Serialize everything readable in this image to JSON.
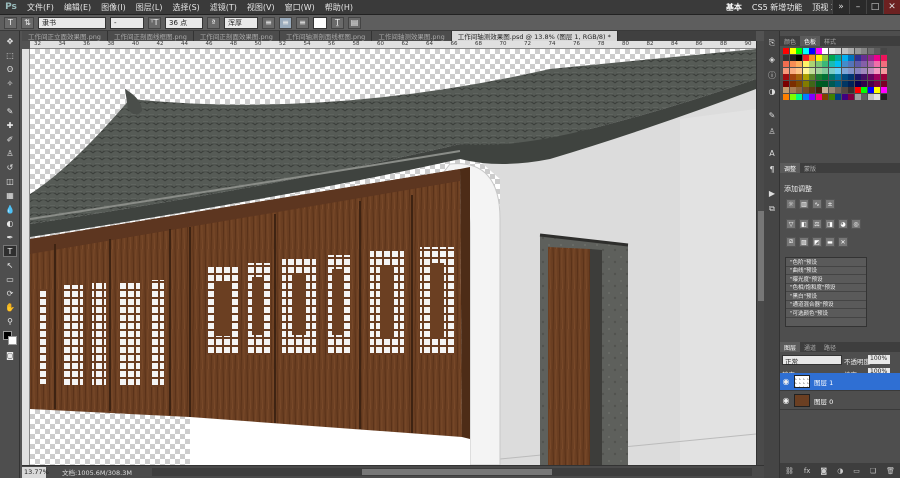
{
  "app": {
    "logo": "Ps"
  },
  "menu": [
    "文件(F)",
    "编辑(E)",
    "图像(I)",
    "图层(L)",
    "选择(S)",
    "滤镜(T)",
    "视图(V)",
    "窗口(W)",
    "帮助(H)"
  ],
  "workspace": {
    "basic": "基本",
    "cs5": "CS5 新增功能",
    "design3d": "顶视 3D"
  },
  "options": {
    "font_family": "隶书",
    "font_style": "-",
    "font_size": "36 点",
    "antialias": "浑厚",
    "zoom_field": "13.8"
  },
  "tabs": [
    "工作间正立面效果图.png",
    "工作间正剖面线框图.png",
    "工作间正剖面效果图.png",
    "工作间轴测剖面线框图.png",
    "工作间轴测效果图.png",
    "工作间轴测效果图.psd @ 13.8% (图层 1, RGB/8) *"
  ],
  "ruler": {
    "top": [
      "32",
      "34",
      "36",
      "38",
      "40",
      "42",
      "44",
      "46",
      "48",
      "50",
      "52",
      "54",
      "56",
      "58",
      "60",
      "62",
      "64",
      "66",
      "68",
      "70",
      "72",
      "74",
      "76",
      "78",
      "80",
      "82",
      "84",
      "86",
      "88",
      "90"
    ]
  },
  "status": {
    "zoom": "13.77%",
    "doc": "文档:1005.6M/308.3M"
  },
  "panels": {
    "swatch_tabs": [
      "颜色",
      "色板",
      "样式"
    ],
    "adjust_tabs": [
      "调整",
      "蒙版"
    ],
    "adjust_title": "添加调整",
    "presets": [
      "\"色阶\"预设",
      "\"曲线\"预设",
      "\"曝光度\"预设",
      "\"色相/饱和度\"预设",
      "\"黑白\"预设",
      "\"通道混合器\"预设",
      "\"可选颜色\"预设"
    ],
    "layers_tabs": [
      "图层",
      "通道",
      "路径"
    ],
    "blend_mode": "正常",
    "opacity_label": "不透明度:",
    "opacity": "100%",
    "lock_label": "锁定:",
    "fill_label": "填充:",
    "fill": "100%",
    "layers": [
      {
        "name": "图层 1",
        "selected": true
      },
      {
        "name": "图层 0",
        "selected": false
      }
    ]
  },
  "colors": {
    "roof": "#585d58",
    "wood": "#6b3f22",
    "accent": "#2f6fd3",
    "wall": "#dcdcdc"
  }
}
